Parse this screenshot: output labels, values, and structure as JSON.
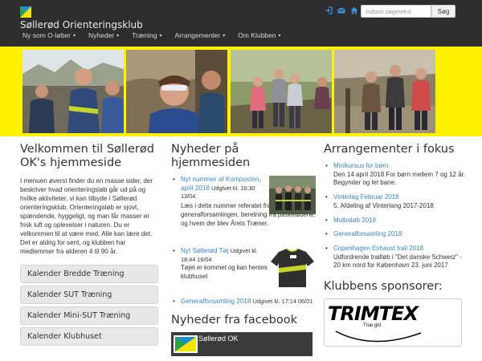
{
  "site": {
    "title": "Søllerød Orienteringsklub",
    "colors": {
      "navbar": "#2d2d2d",
      "brand_yellow": "#fff200",
      "link": "#3a86c8"
    }
  },
  "nav": {
    "items": [
      {
        "label": "Ny som O-løber",
        "caret": "▾"
      },
      {
        "label": "Nyheder",
        "caret": "▾"
      },
      {
        "label": "Træning",
        "caret": "▾"
      },
      {
        "label": "Arrangementer",
        "caret": "▾"
      },
      {
        "label": "Om Klubben",
        "caret": "▾"
      }
    ],
    "utility_icons": [
      "login-icon",
      "envelope-icon",
      "home-icon"
    ]
  },
  "search": {
    "placeholder": "Indtast søgetekst",
    "button_label": "Søg"
  },
  "welcome": {
    "title": "Velkommen til Søllerød OK's hjemmeside",
    "body": "I menuen øverst finder du en masse sider, der beskriver hvad orienteringsløb går ud på og hvilke aktiviteter, vi kan tilbyde i Søllerød orienteringsklub. Orienteringsløb er sjovt, spændende, hyggeligt, og man får masser er frisk luft og oplevelser i naturen. Du er velkommen til at være med. Alle kan lære det. Det er aldrig for sent, og klubben har medlemmer fra alderen 4 til 90 år."
  },
  "calendars": [
    "Kalender Bredde Træning",
    "Kalender SUT Træning",
    "Kalender Mini-SUT Træning",
    "Kalender Klubhuset"
  ],
  "news": {
    "title": "Nyheder på hjemmesiden",
    "items": [
      {
        "link": "Nyt nummer af Komposten, april 2018",
        "meta": "Udgivet kl. 16:30 13/04",
        "text": "Læs i dette nummer referatet fra generalforsamlingen, beretning fra påskeløbene, og hvem der blev Årets Træner."
      },
      {
        "link": "Nyt Søllerød Tøj",
        "meta": "Udgivet kl. 18:44 16/04",
        "text": "Tøjet er kommet og kan hentes i klubhuset"
      },
      {
        "link": "Generalforsamling 2018",
        "meta": "Udgivet kl. 17:14 06/01",
        "text": ""
      }
    ]
  },
  "facebook": {
    "title": "Nyheder fra facebook",
    "page_name": "Søllerød OK"
  },
  "events": {
    "title": "Arrangementer i fokus",
    "items": [
      {
        "link": "Minikursus for børn",
        "text": "Den 14 april 2018 For børn mellem 7 og 12 år. Begynder og let bane."
      },
      {
        "link": "Vinterlag Februar 2018",
        "text": "5. Afdeling af Vinterlang 2017-2018"
      },
      {
        "link": "Molboløb 2018",
        "text": ""
      },
      {
        "link": "Generalforsamling 2018",
        "text": ""
      },
      {
        "link": "Copenhagen Exhaust trail 2018",
        "text": "Udfordrende trailløb i \"Det danske Schweiz\" - 20 km nord for København 23. juni 2017"
      }
    ]
  },
  "sponsor": {
    "title": "Klubbens sponsorer:",
    "logo_text": "TRIMTEX",
    "tagline": "True grit"
  }
}
